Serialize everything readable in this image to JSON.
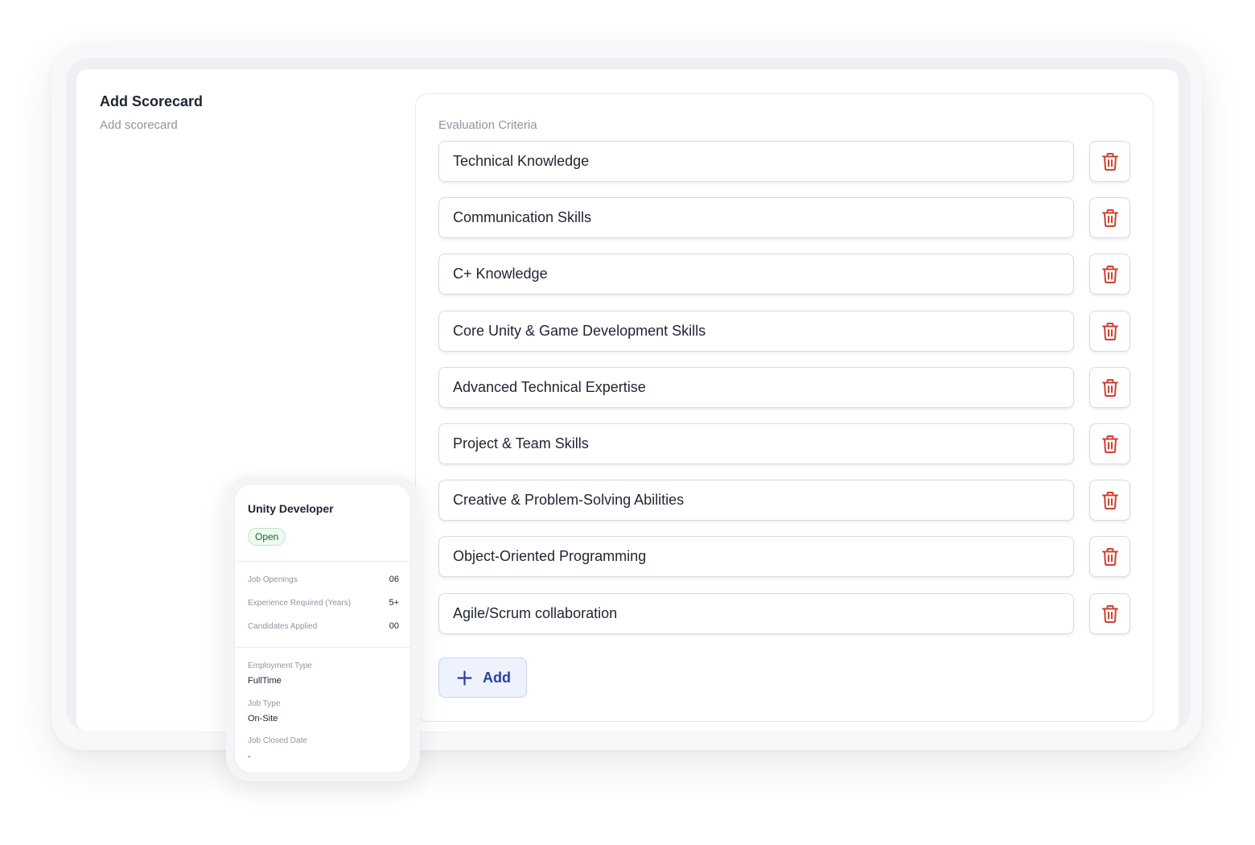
{
  "header": {
    "title": "Add Scorecard",
    "subtitle": "Add scorecard"
  },
  "criteria": {
    "section_label": "Evaluation Criteria",
    "items": [
      "Technical Knowledge",
      "Communication Skills",
      "C+ Knowledge",
      "Core Unity & Game Development Skills",
      "Advanced Technical Expertise",
      "Project & Team Skills",
      "Creative & Problem-Solving Abilities",
      "Object-Oriented Programming",
      "Agile/Scrum collaboration"
    ],
    "delete_icon": "trash-icon",
    "add_label": "Add",
    "add_icon": "plus-icon"
  },
  "job_card": {
    "title": "Unity Developer",
    "status": "Open",
    "stats": [
      {
        "label": "Job Openings",
        "value": "06"
      },
      {
        "label": "Experience Required (Years)",
        "value": "5+"
      },
      {
        "label": "Candidates Applied",
        "value": "00"
      }
    ],
    "details": [
      {
        "label": "Employment Type",
        "value": "FullTime"
      },
      {
        "label": "Job Type",
        "value": "On-Site"
      },
      {
        "label": "Job Closed Date",
        "value": "-"
      }
    ]
  },
  "colors": {
    "delete": "#d0402f",
    "add_text": "#2d3ea0",
    "add_bg": "#eef2fd",
    "status_green": "#17652f"
  }
}
